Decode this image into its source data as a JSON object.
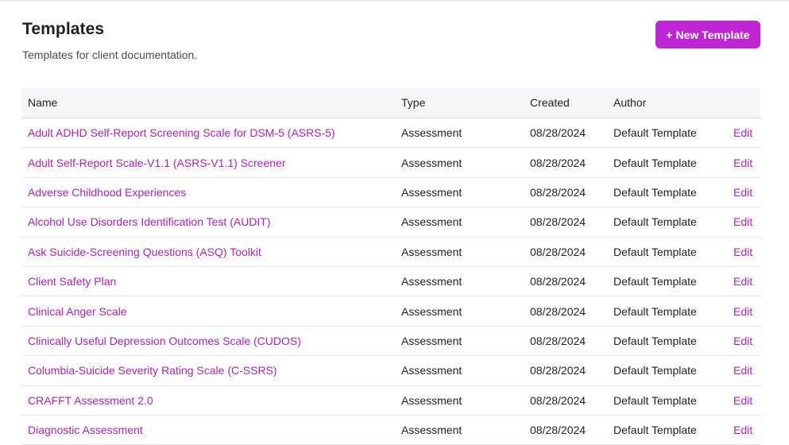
{
  "header": {
    "title": "Templates",
    "subtitle": "Templates for client documentation.",
    "new_button_label": "+ New Template"
  },
  "table": {
    "columns": [
      "Name",
      "Type",
      "Created",
      "Author",
      ""
    ],
    "rows": [
      {
        "name": "Adult ADHD Self-Report Screening Scale for DSM-5 (ASRS-5)",
        "type": "Assessment",
        "created": "08/28/2024",
        "author": "Default Template",
        "action": "Edit"
      },
      {
        "name": "Adult Self-Report Scale-V1.1 (ASRS-V1.1) Screener",
        "type": "Assessment",
        "created": "08/28/2024",
        "author": "Default Template",
        "action": "Edit"
      },
      {
        "name": "Adverse Childhood Experiences",
        "type": "Assessment",
        "created": "08/28/2024",
        "author": "Default Template",
        "action": "Edit"
      },
      {
        "name": "Alcohol Use Disorders Identification Test (AUDIT)",
        "type": "Assessment",
        "created": "08/28/2024",
        "author": "Default Template",
        "action": "Edit"
      },
      {
        "name": "Ask Suicide-Screening Questions (ASQ) Toolkit",
        "type": "Assessment",
        "created": "08/28/2024",
        "author": "Default Template",
        "action": "Edit"
      },
      {
        "name": "Client Safety Plan",
        "type": "Assessment",
        "created": "08/28/2024",
        "author": "Default Template",
        "action": "Edit"
      },
      {
        "name": "Clinical Anger Scale",
        "type": "Assessment",
        "created": "08/28/2024",
        "author": "Default Template",
        "action": "Edit"
      },
      {
        "name": "Clinically Useful Depression Outcomes Scale (CUDOS)",
        "type": "Assessment",
        "created": "08/28/2024",
        "author": "Default Template",
        "action": "Edit"
      },
      {
        "name": "Columbia-Suicide Severity Rating Scale (C-SSRS)",
        "type": "Assessment",
        "created": "08/28/2024",
        "author": "Default Template",
        "action": "Edit"
      },
      {
        "name": "CRAFFT Assessment 2.0",
        "type": "Assessment",
        "created": "08/28/2024",
        "author": "Default Template",
        "action": "Edit"
      },
      {
        "name": "Diagnostic Assessment",
        "type": "Assessment",
        "created": "08/28/2024",
        "author": "Default Template",
        "action": "Edit"
      }
    ]
  },
  "colors": {
    "accent": "#c025d3",
    "link": "#b31fc4",
    "header_bg": "#f6f6f8"
  }
}
